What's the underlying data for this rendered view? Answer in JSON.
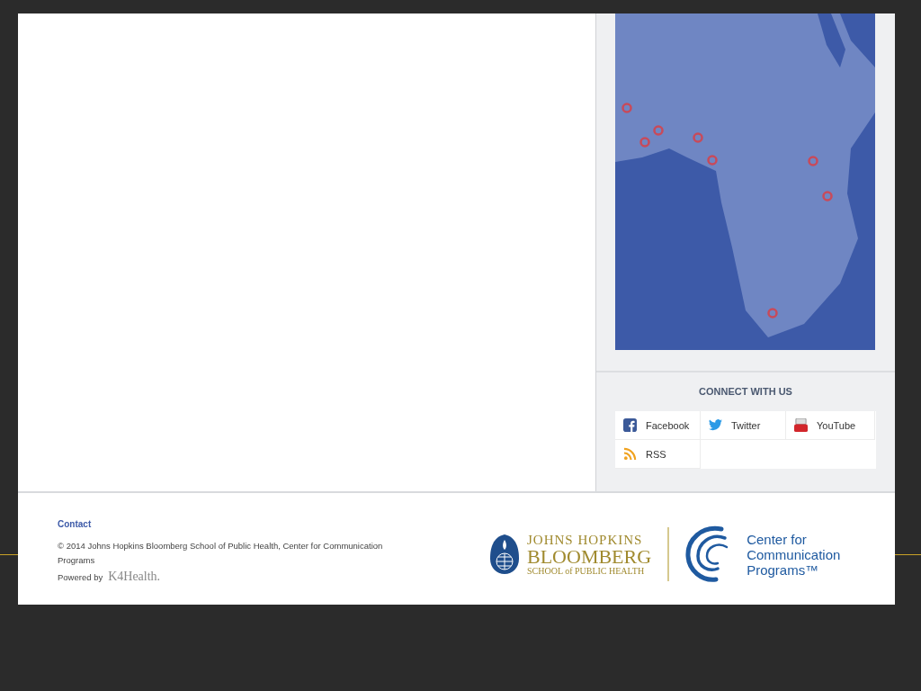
{
  "sidebar": {
    "connect": {
      "heading": "CONNECT WITH US",
      "links": [
        {
          "kind": "facebook",
          "label": "Facebook"
        },
        {
          "kind": "twitter",
          "label": "Twitter"
        },
        {
          "kind": "youtube",
          "label": "YouTube"
        },
        {
          "kind": "rss",
          "label": "RSS"
        }
      ]
    }
  },
  "footer": {
    "contact": "Contact",
    "copyright": "© 2014 Johns Hopkins Bloomberg School of Public Health, Center for Communication Programs",
    "powered_by": "Powered by",
    "powered_logo": "K4Health.",
    "jhu_logo": {
      "line_1": "JOHNS HOPKINS",
      "line_2": "BLOOMBERG",
      "line_3": "SCHOOL of PUBLIC HEALTH"
    },
    "ccp_logo": {
      "line_1": "Center for",
      "line_2": "Communication",
      "line_3": "Programs™"
    }
  }
}
